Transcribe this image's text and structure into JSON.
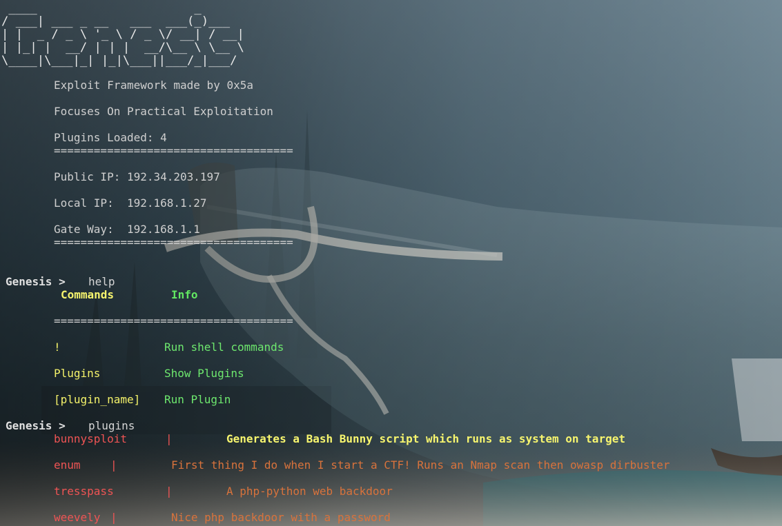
{
  "banner": " ____                      _\n/ ___| ___ _ __   ___  ___(_)___\n| |  _ / _ \\ '_ \\ / _ \\/ __| / __|\n| |_| |  __/ | | |  __/\\__ \\ \\__ \\\n\\____|\\___|_| |_|\\___||___/_|___/",
  "intro": {
    "tagline": "Exploit Framework made by 0x5a",
    "focus": "Focuses On Practical Exploitation",
    "plugins_loaded": "Plugins Loaded: 4",
    "separator": "===================================="
  },
  "network": {
    "public_ip": "Public IP: 192.34.203.197",
    "local_ip": "Local IP:  192.168.1.27",
    "gateway": "Gate Way:  192.168.1.1",
    "separator": "===================================="
  },
  "help_cmd": {
    "prompt": "Genesis >",
    "command": "help",
    "header_commands": "Commands",
    "header_info": "Info",
    "separator": "====================================",
    "rows": [
      {
        "cmd": "!",
        "info": "Run shell commands"
      },
      {
        "cmd": "Plugins",
        "info": "Show Plugins"
      },
      {
        "cmd": "[plugin_name]",
        "info": "Run Plugin"
      }
    ]
  },
  "plugins_cmd": {
    "prompt": "Genesis >",
    "command": "plugins",
    "rows": [
      {
        "name": "bunnysploit",
        "sep": "|",
        "desc": "Generates a Bash Bunny script which runs as system on target"
      },
      {
        "name": "enum",
        "sep": "|",
        "desc": "First thing I do when I start a CTF! Runs an Nmap scan then owasp dirbuster"
      },
      {
        "name": "tresspass",
        "sep": "|",
        "desc": "A php-python web backdoor"
      },
      {
        "name": "weevely",
        "sep": "|",
        "desc": "Nice php backdoor with a password"
      }
    ]
  },
  "colors": {
    "banner": "#e8e8e8",
    "text": "#c8c8c8",
    "command_yellow": "#f4f26a",
    "info_green": "#6ee86e",
    "plugin_red": "#ef5454",
    "desc_orange": "#d9733c"
  }
}
